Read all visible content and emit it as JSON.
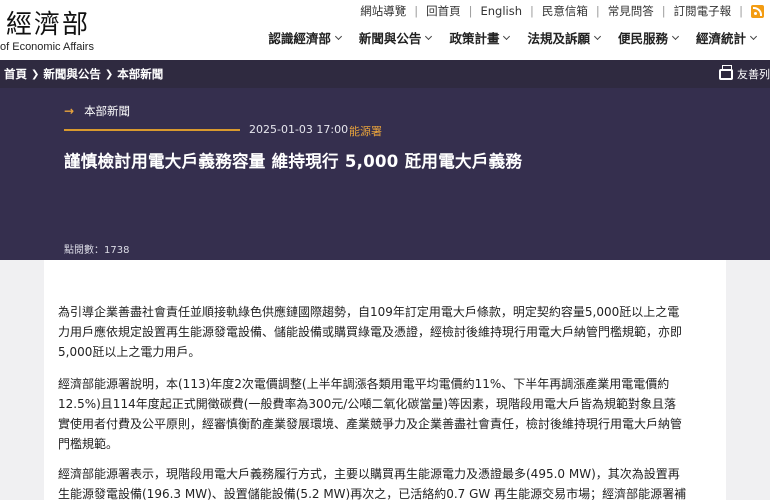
{
  "header": {
    "logo_cn": "經濟部",
    "logo_en": "of Economic Affairs",
    "util_links": [
      "網站導覽",
      "回首頁",
      "English",
      "民意信箱",
      "常見問答",
      "訂閱電子報"
    ],
    "rss_icon": "rss-icon",
    "main_nav": [
      "認識經濟部",
      "新聞與公告",
      "政策計畫",
      "法規及訴願",
      "便民服務",
      "經濟統計"
    ]
  },
  "breadcrumb": {
    "items": [
      "首頁",
      "新聞與公告",
      "本部新聞"
    ],
    "print_label": "友善列"
  },
  "article": {
    "category": "本部新聞",
    "date": "2025-01-03 17:00",
    "department": "能源署",
    "title": "謹慎檢討用電大戶義務容量 維持現行 5,000 瓩用電大戶義務",
    "views": "點閱數：1738",
    "paragraphs": [
      [
        "為引導企業善盡社會責任並順接軌綠色供應鏈國際趨勢，自109年訂定用電大戶條款，明定契約容量5,000瓩以上之電",
        "力用戶應依規定設置再生能源發電設備、儲能設備或購買綠電及憑證，經檢討後維持現行用電大戶納管門檻規範，亦即",
        "5,000瓩以上之電力用戶。"
      ],
      [
        "經濟部能源署說明，本(113)年度2次電價調整(上半年調漲各類用電平均電價約11%、下半年再調漲產業用電電價約",
        "12.5%)且114年度起正式開徵碳費(一般費率為300元/公噸二氧化碳當量)等因素，現階段用電大戶皆為規範對象且落",
        "實使用者付費及公平原則，經審慎衡酌產業發展環境、產業競爭力及企業善盡社會責任，檢討後維持現行用電大戶納管",
        "門檻規範。"
      ],
      [
        "經濟部能源署表示，現階段用電大戶義務履行方式，主要以購買再生能源電力及憑證最多(495.0 MW)，其次為設置再",
        "生能源發電設備(196.3 MW)、設置儲能設備(5.2 MW)再次之，已活絡約0.7 GW 再生能源交易市場；經濟部能源署補"
      ]
    ]
  },
  "colors": {
    "breadcrumb_bg": "#2f2a40",
    "hero_bg": "#352f4e",
    "accent": "#e8a33c",
    "page_bg": "#f0f0f2"
  }
}
